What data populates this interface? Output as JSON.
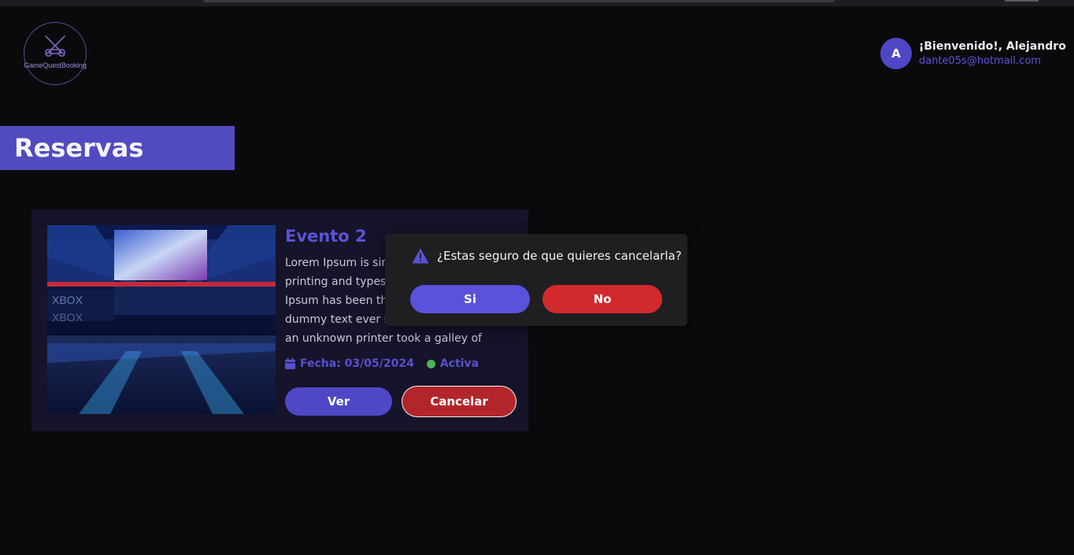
{
  "header": {
    "logo_text": "GameQuestBooking",
    "user": {
      "avatar_initial": "A",
      "greeting": "¡Bienvenido!, Alejandro",
      "email": "dante05s@hotmail.com"
    }
  },
  "section": {
    "title": "Reservas"
  },
  "reservation": {
    "title": "Evento 2",
    "description": "Lorem Ipsum is simply dummy text of the printing and typesetting industry. Lorem Ipsum has been the industry's standard dummy text ever since the 1500s, when an unknown printer took a galley of type…",
    "date_label": "Fecha: 03/05/2024",
    "status": "Activa",
    "status_color": "#4fb35a",
    "view_button": "Ver",
    "cancel_button": "Cancelar"
  },
  "dialog": {
    "icon": "warning-icon",
    "message": "¿Estas seguro de que quieres cancelarla?",
    "confirm_label": "Si",
    "deny_label": "No"
  },
  "colors": {
    "accent": "#524ac0",
    "danger": "#d22a2c",
    "background": "#0a0a0d"
  }
}
